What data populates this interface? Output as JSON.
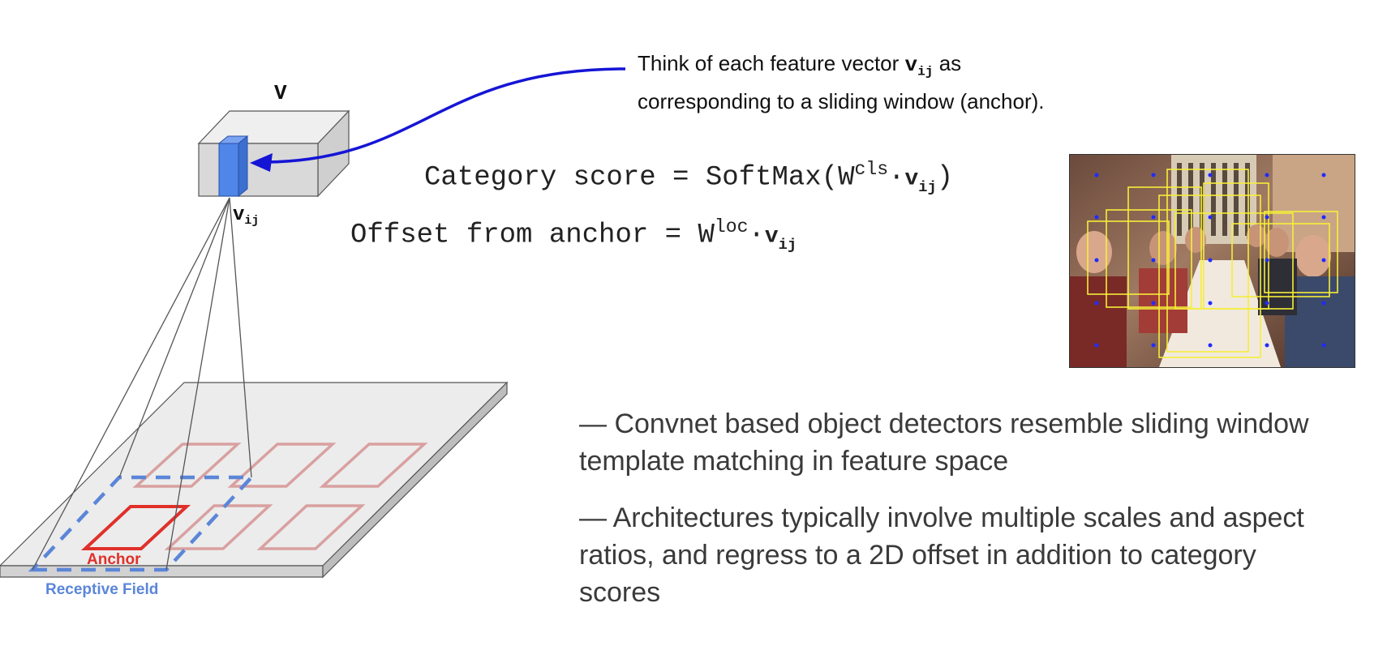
{
  "callout": {
    "prefix": "Think of each feature vector ",
    "var": "v",
    "var_sub": "ij",
    "suffix": " as",
    "line2": "corresponding to a sliding window (anchor)."
  },
  "equations": {
    "category": {
      "lhs": "Category score = SoftMax(W",
      "sup": "cls",
      "dot": "·",
      "var": "v",
      "sub": "ij",
      "close": ")"
    },
    "offset": {
      "lhs": "Offset from anchor = W",
      "sup": "loc",
      "dot": "·",
      "var": "v",
      "sub": "ij"
    }
  },
  "diagram": {
    "volume_label": "V",
    "vector_label": "v",
    "vector_sub": "ij",
    "anchor_label": "Anchor",
    "receptive_field_label": "Receptive Field"
  },
  "bullets": [
    "— Convnet based object detectors resemble sliding window template matching in feature space",
    "— Architectures typically involve multiple scales and aspect ratios, and regress to a 2D offset in addition to category scores"
  ],
  "colors": {
    "arrow": "#1515d6",
    "vector": "#4f86e8",
    "anchor": "#e0302a",
    "receptive_field": "#5b86d8",
    "faded_anchor": "#d9a0a0",
    "box_yellow": "#f5ee3a",
    "dot_blue": "#1f2cff"
  }
}
